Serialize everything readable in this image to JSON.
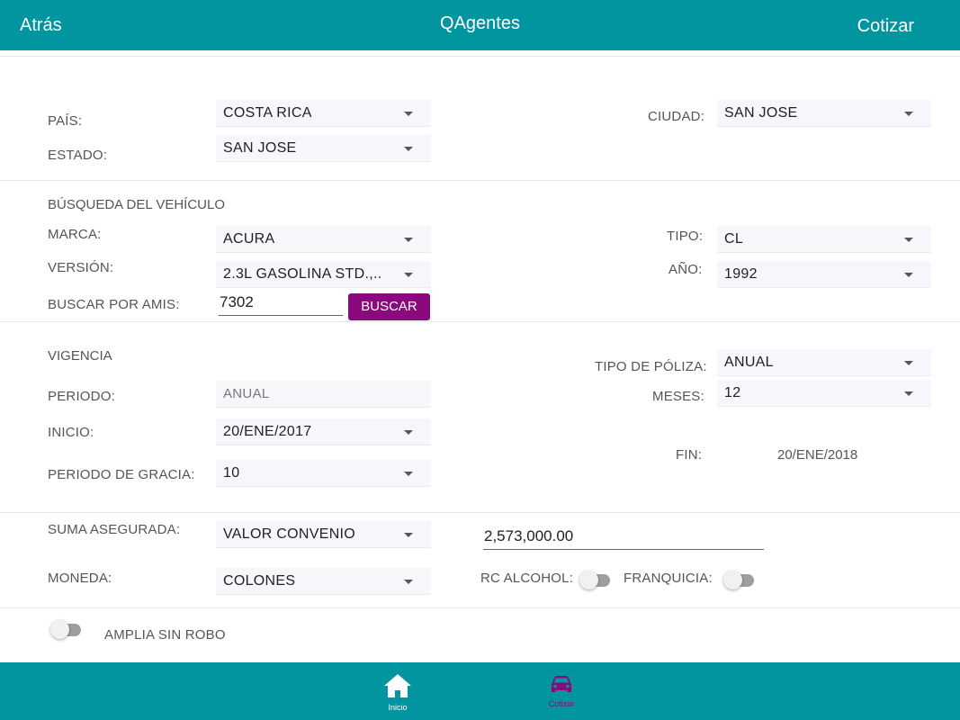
{
  "header": {
    "back": "Atrás",
    "title": "QAgentes",
    "action": "Cotizar"
  },
  "location": {
    "country_label": "PAÍS:",
    "country_value": "COSTA RICA",
    "state_label": "ESTADO:",
    "state_value": "SAN JOSE",
    "city_label": "CIUDAD:",
    "city_value": "SAN JOSE"
  },
  "vehicle": {
    "section_title": "BÚSQUEDA DEL VEHÍCULO",
    "brand_label": "MARCA:",
    "brand_value": "ACURA",
    "version_label": "VERSIÓN:",
    "version_value": "2.3L GASOLINA STD.,..",
    "amis_label": "BUSCAR POR AMIS:",
    "amis_value": "7302",
    "search_button": "BUSCAR",
    "type_label": "TIPO:",
    "type_value": "CL",
    "year_label": "AÑO:",
    "year_value": "1992"
  },
  "validity": {
    "section_title": "VIGENCIA",
    "period_label": "PERIODO:",
    "period_value": "ANUAL",
    "start_label": "INICIO:",
    "start_value": "20/ENE/2017",
    "grace_label": "PERIODO DE GRACIA:",
    "grace_value": "10",
    "policy_type_label": "TIPO DE PÓLIZA:",
    "policy_type_value": "ANUAL",
    "months_label": "MESES:",
    "months_value": "12",
    "end_label": "FIN:",
    "end_value": "20/ENE/2018"
  },
  "coverage": {
    "sum_label": "SUMA ASEGURADA:",
    "sum_type_value": "VALOR CONVENIO",
    "sum_amount": "2,573,000.00",
    "currency_label": "MONEDA:",
    "currency_value": "COLONES",
    "rc_alcohol_label": "RC ALCOHOL:",
    "rc_alcohol_on": false,
    "deductible_label": "FRANQUICIA:",
    "deductible_on": false,
    "amplia_label": "AMPLIA SIN ROBO",
    "amplia_on": false
  },
  "bottom_nav": {
    "items": [
      {
        "label": "Inicio",
        "icon": "home-icon",
        "active": false
      },
      {
        "label": "Cotizar",
        "icon": "car-icon",
        "active": true
      }
    ]
  },
  "colors": {
    "primary": "#00959f",
    "accent": "#8a0a7e",
    "text_on_primary": "#ffffff"
  }
}
